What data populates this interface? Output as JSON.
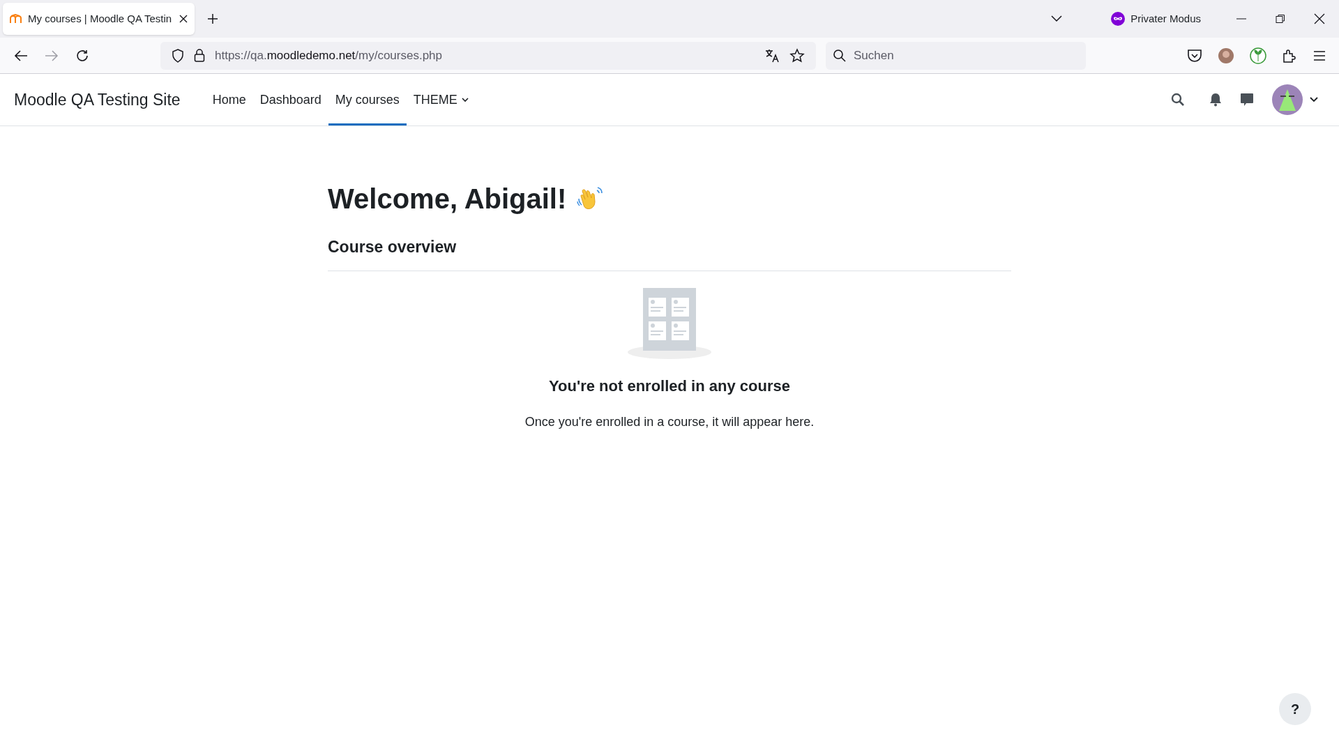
{
  "browser": {
    "tabs": [
      {
        "title": "My courses | Moodle QA Testin",
        "selected": true
      }
    ],
    "private_label": "Privater Modus",
    "url": {
      "prefix": "https://qa.",
      "domain": "moodledemo.net",
      "path": "/my/courses.php"
    },
    "search": {
      "placeholder": "Suchen"
    }
  },
  "site": {
    "name": "Moodle QA Testing Site",
    "nav": [
      {
        "label": "Home",
        "selected": false,
        "kind": "link"
      },
      {
        "label": "Dashboard",
        "selected": false,
        "kind": "link"
      },
      {
        "label": "My courses",
        "selected": true,
        "kind": "link"
      },
      {
        "label": "THEME",
        "selected": false,
        "kind": "menu"
      }
    ]
  },
  "main": {
    "heading": "Welcome, Abigail!",
    "section_title": "Course overview",
    "empty_title": "You're not enrolled in any course",
    "empty_text": "Once you're enrolled in a course, it will appear here."
  },
  "help_button": "?"
}
